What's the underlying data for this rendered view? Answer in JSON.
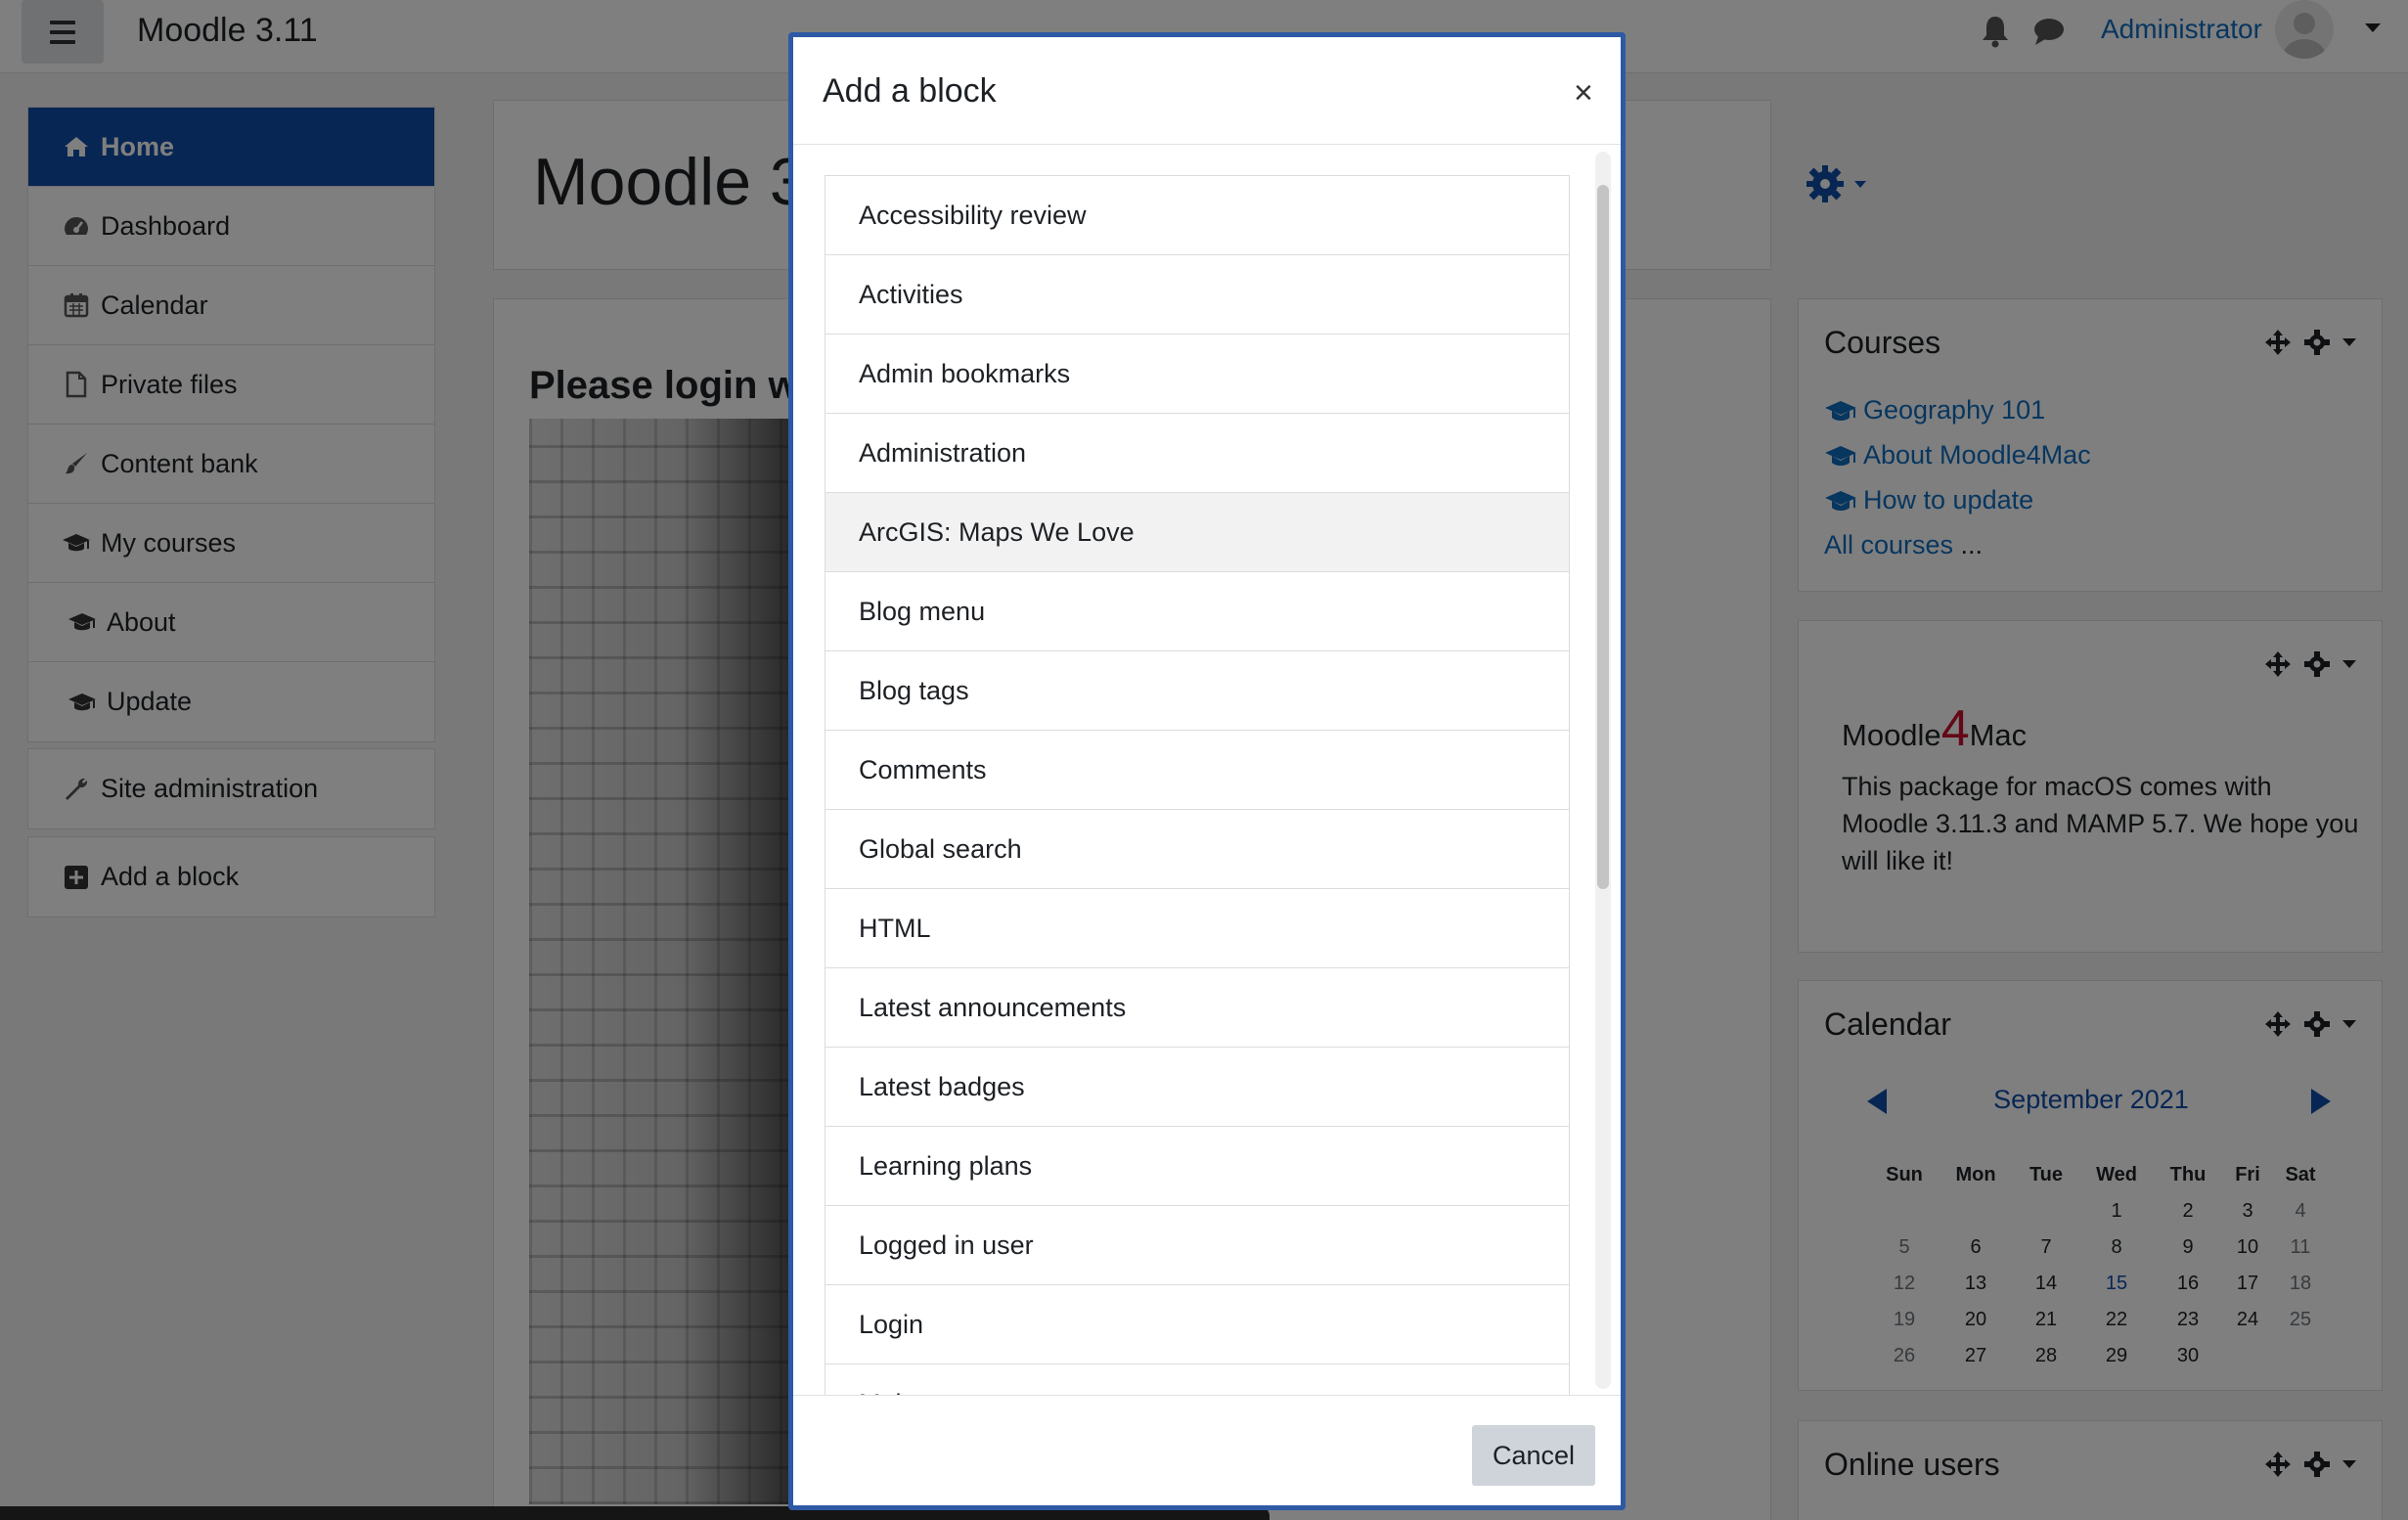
{
  "navbar": {
    "site_name": "Moodle 3.11",
    "user_name": "Administrator"
  },
  "sidebar": {
    "items": [
      {
        "label": "Home",
        "icon": "home-icon"
      },
      {
        "label": "Dashboard",
        "icon": "dashboard-icon"
      },
      {
        "label": "Calendar",
        "icon": "calendar-icon"
      },
      {
        "label": "Private files",
        "icon": "file-icon"
      },
      {
        "label": "Content bank",
        "icon": "brush-icon"
      },
      {
        "label": "My courses",
        "icon": "graduation-cap-icon"
      },
      {
        "label": "About",
        "icon": "graduation-cap-icon"
      },
      {
        "label": "Update",
        "icon": "graduation-cap-icon"
      }
    ],
    "site_admin": "Site administration",
    "add_block": "Add a block"
  },
  "main": {
    "page_title": "Moodle 3",
    "login_heading": "Please login w"
  },
  "blocks": {
    "courses": {
      "title": "Courses",
      "links": [
        "Geography 101",
        "About Moodle4Mac",
        "How to update"
      ],
      "all_courses": "All courses",
      "all_courses_suffix": " ..."
    },
    "moodle4mac": {
      "logo_left": "Moodle",
      "logo_four": "4",
      "logo_right": "Mac",
      "text": "This package for macOS comes with Moodle 3.11.3 and MAMP 5.7. We hope you will like it!"
    },
    "calendar": {
      "title": "Calendar",
      "month": "September 2021",
      "weekdays": [
        "Sun",
        "Mon",
        "Tue",
        "Wed",
        "Thu",
        "Fri",
        "Sat"
      ],
      "weeks": [
        [
          "",
          "",
          "",
          "1",
          "2",
          "3",
          "4"
        ],
        [
          "5",
          "6",
          "7",
          "8",
          "9",
          "10",
          "11"
        ],
        [
          "12",
          "13",
          "14",
          "15",
          "16",
          "17",
          "18"
        ],
        [
          "19",
          "20",
          "21",
          "22",
          "23",
          "24",
          "25"
        ],
        [
          "26",
          "27",
          "28",
          "29",
          "30",
          "",
          ""
        ]
      ],
      "today": "15"
    },
    "online_users": {
      "title": "Online users"
    }
  },
  "modal": {
    "title": "Add a block",
    "close": "×",
    "items": [
      "Accessibility review",
      "Activities",
      "Admin bookmarks",
      "Administration",
      "ArcGIS: Maps We Love",
      "Blog menu",
      "Blog tags",
      "Comments",
      "Global search",
      "HTML",
      "Latest announcements",
      "Latest badges",
      "Learning plans",
      "Logged in user",
      "Login",
      "Main menu"
    ],
    "hover_index": 4,
    "cancel_label": "Cancel"
  },
  "colors": {
    "accent": "#0f4da8",
    "link": "#0f6cbf",
    "moodle_four": "#c8102e",
    "modal_border": "#2e5aa5"
  }
}
